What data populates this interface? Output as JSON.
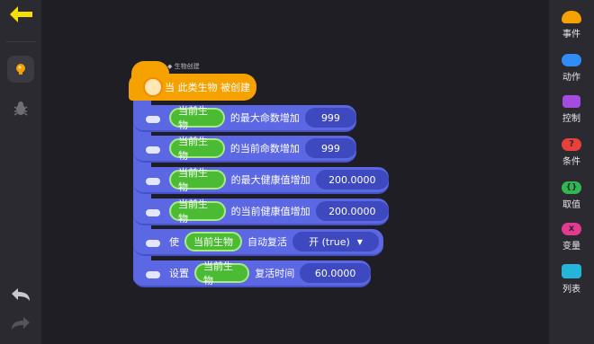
{
  "hat": {
    "caption": "◆ 生物创建",
    "title": "当 此类生物 被创建"
  },
  "blocks": [
    {
      "target": "当前生物",
      "text": "的最大命数增加",
      "value": "999"
    },
    {
      "target": "当前生物",
      "text": "的当前命数增加",
      "value": "999"
    },
    {
      "target": "当前生物",
      "text": "的最大健康值增加",
      "value": "200.0000"
    },
    {
      "target": "当前生物",
      "text": "的当前健康值增加",
      "value": "200.0000"
    }
  ],
  "revive_block": {
    "prefix": "使",
    "target": "当前生物",
    "text": "自动复活",
    "value": "开 (true)"
  },
  "time_block": {
    "prefix": "设置",
    "target": "当前生物",
    "text": "复活时间",
    "value": "60.0000"
  },
  "categories": [
    {
      "label": "事件",
      "color": "#f5a100"
    },
    {
      "label": "动作",
      "color": "#2f8df5"
    },
    {
      "label": "控制",
      "color": "#a44ce0"
    },
    {
      "label": "条件",
      "color": "#e8413c"
    },
    {
      "label": "取值",
      "color": "#2fb84f"
    },
    {
      "label": "变量",
      "color": "#e23a8e"
    },
    {
      "label": "列表",
      "color": "#26b4d8"
    }
  ]
}
